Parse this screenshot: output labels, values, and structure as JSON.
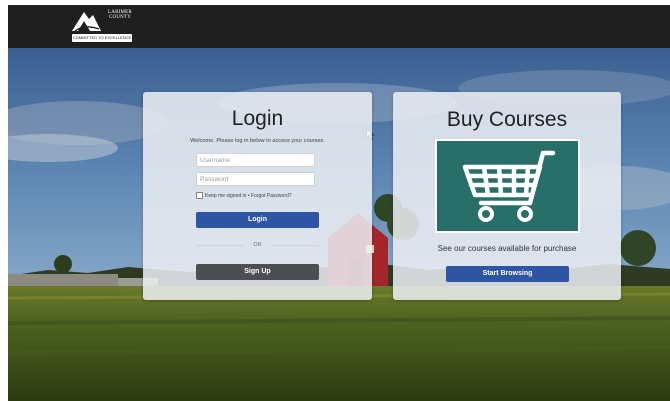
{
  "header": {
    "logo": {
      "name": "LARIMER COUNTY",
      "tagline": "COMMITTED TO EXCELLENCE",
      "icon": "mountain-logo-icon"
    }
  },
  "login": {
    "title": "Login",
    "welcome": "Welcome. Please log in below to access your courses.",
    "username_placeholder": "Username",
    "username_value": "",
    "password_placeholder": "Password",
    "password_value": "",
    "remember_label": "Keep me signed in",
    "separator": "•",
    "forgot_label": "Forgot Password?",
    "login_button": "Login",
    "or_label": "OR",
    "signup_button": "Sign Up"
  },
  "buy": {
    "title": "Buy Courses",
    "icon": "shopping-cart-icon",
    "tagline": "See our courses available for purchase",
    "browse_button": "Start Browsing"
  },
  "colors": {
    "topbar": "#1f1f1f",
    "primary_button": "#2e54a4",
    "secondary_button": "#4d4e52",
    "cart_tile": "#286f6a"
  }
}
